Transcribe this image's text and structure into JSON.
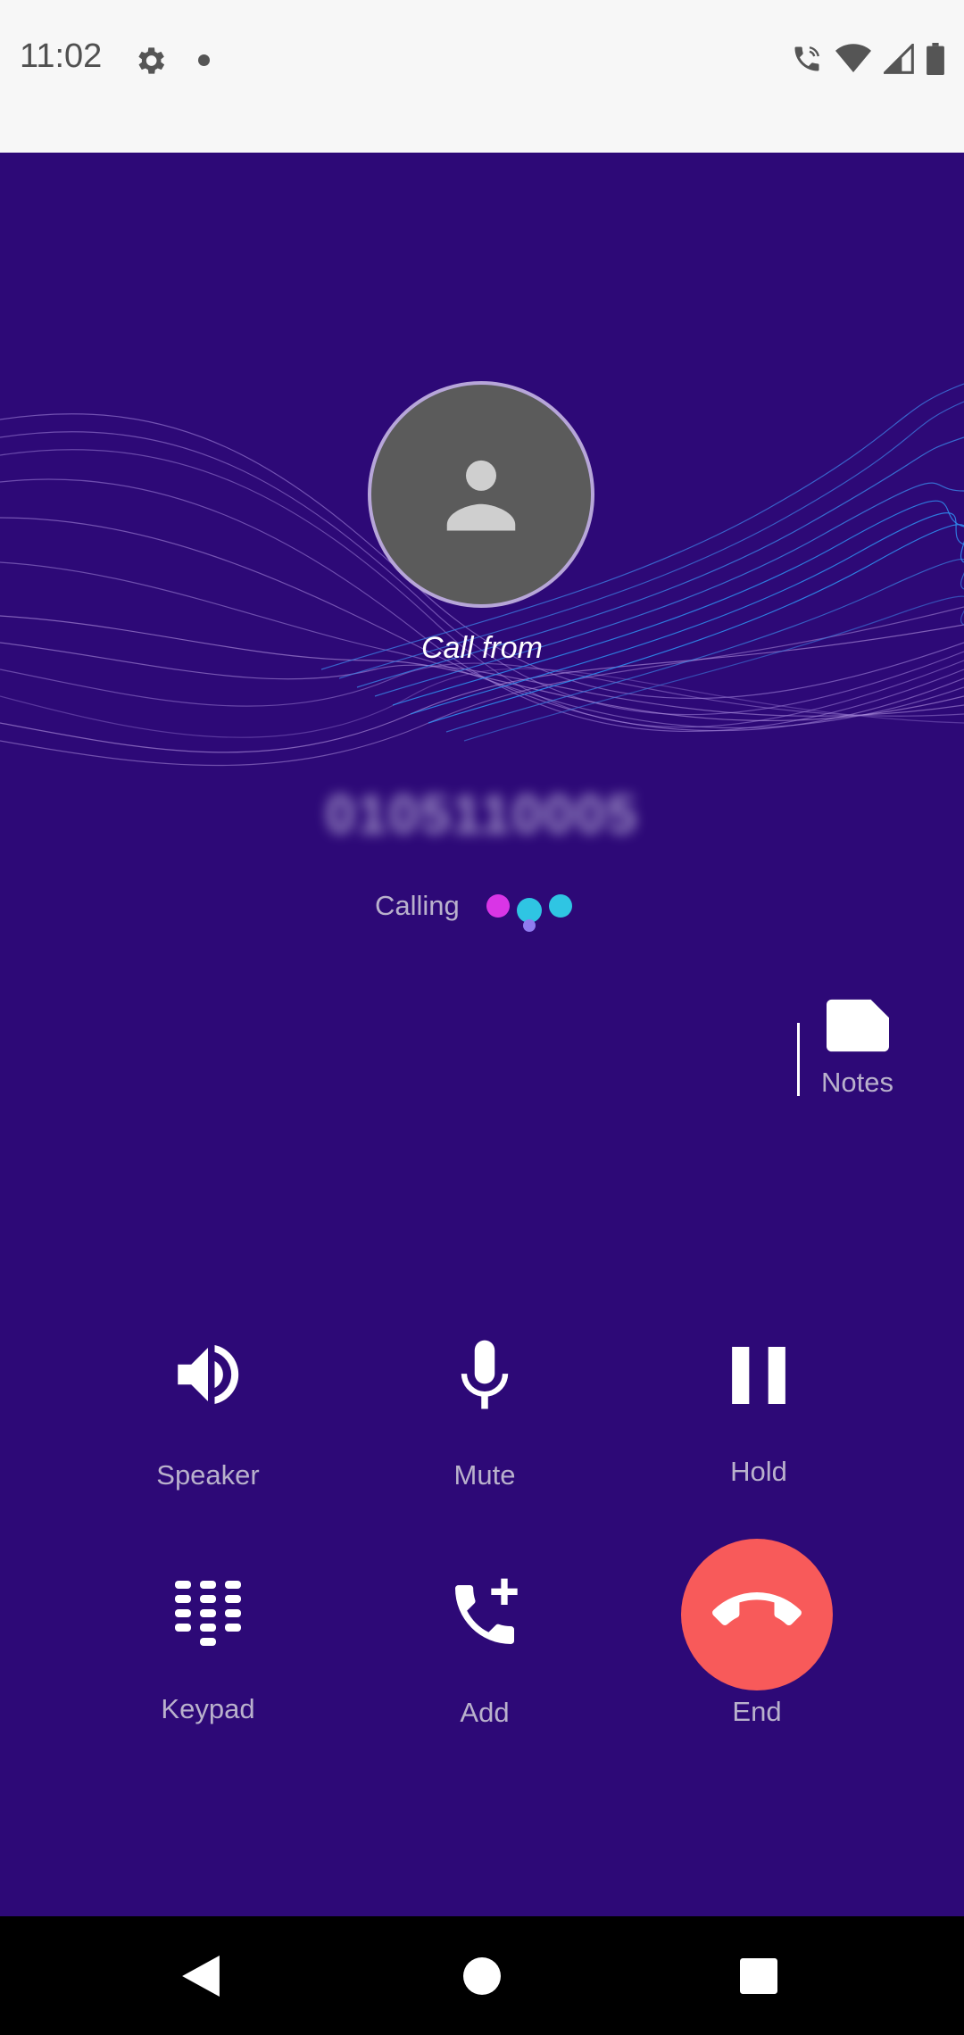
{
  "status_bar": {
    "time": "11:02",
    "icons": [
      "settings-gear-icon",
      "notification-dot-icon",
      "wifi-call-icon",
      "wifi-icon",
      "cell-signal-icon",
      "battery-icon"
    ]
  },
  "call": {
    "header": "Call from",
    "number": "0105110005",
    "status": "Calling"
  },
  "notes": {
    "label": "Notes",
    "icon": "note-icon"
  },
  "controls": {
    "speaker": {
      "label": "Speaker",
      "icon": "speaker-icon"
    },
    "mute": {
      "label": "Mute",
      "icon": "microphone-icon"
    },
    "hold": {
      "label": "Hold",
      "icon": "pause-icon"
    },
    "keypad": {
      "label": "Keypad",
      "icon": "dialpad-icon"
    },
    "add": {
      "label": "Add",
      "icon": "add-call-icon"
    },
    "end": {
      "label": "End",
      "icon": "hang-up-icon"
    }
  },
  "colors": {
    "background": "#2d0977",
    "end_call": "#f85a5a",
    "label": "#b9b1cc",
    "dot_magenta": "#d935e6",
    "dot_cyan": "#2fc5e3",
    "dot_lavender": "#8f7bf0"
  },
  "nav_bar": {
    "buttons": [
      "back-icon",
      "home-icon",
      "recents-icon"
    ]
  }
}
